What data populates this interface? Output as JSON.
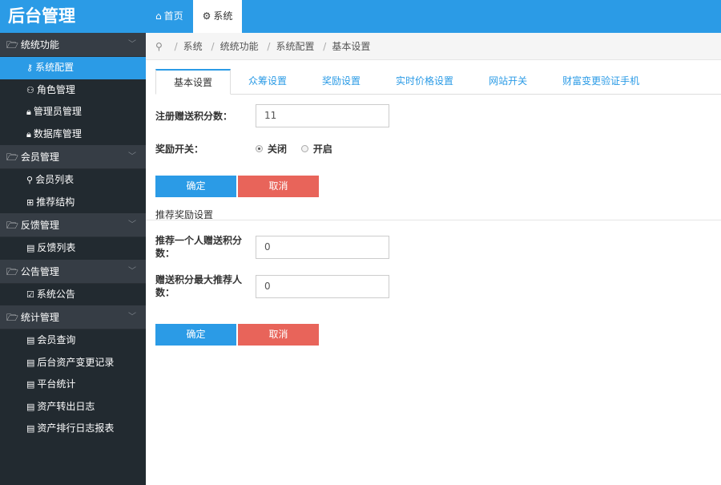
{
  "app": {
    "logo": "后台管理"
  },
  "topnav": {
    "items": [
      {
        "label": "首页",
        "icon": "home-icon"
      },
      {
        "label": "系统",
        "icon": "gear-icon"
      }
    ]
  },
  "sidebar": {
    "groups": [
      {
        "title": "统统功能",
        "items": [
          {
            "label": "系统配置",
            "icon": "wrench-icon"
          },
          {
            "label": "角色管理",
            "icon": "users-icon"
          },
          {
            "label": "管理员管理",
            "icon": "lock-icon"
          },
          {
            "label": "数据库管理",
            "icon": "lock-icon"
          }
        ]
      },
      {
        "title": "会员管理",
        "items": [
          {
            "label": "会员列表",
            "icon": "user-icon"
          },
          {
            "label": "推荐结构",
            "icon": "grid-icon"
          }
        ]
      },
      {
        "title": "反馈管理",
        "items": [
          {
            "label": "反馈列表",
            "icon": "document-icon"
          }
        ]
      },
      {
        "title": "公告管理",
        "items": [
          {
            "label": "系统公告",
            "icon": "checkbox-icon"
          }
        ]
      },
      {
        "title": "统计管理",
        "items": [
          {
            "label": "会员查询",
            "icon": "document-icon"
          },
          {
            "label": "后台资产变更记录",
            "icon": "document-icon"
          },
          {
            "label": "平台统计",
            "icon": "document-icon"
          },
          {
            "label": "资产转出日志",
            "icon": "document-icon"
          },
          {
            "label": "资产排行日志报表",
            "icon": "document-icon"
          }
        ]
      }
    ]
  },
  "breadcrumb": {
    "items": [
      "系统",
      "统统功能",
      "系统配置",
      "基本设置"
    ],
    "sep": "/"
  },
  "tabs": [
    "基本设置",
    "众筹设置",
    "奖励设置",
    "实时价格设置",
    "网站开关",
    "财富变更验证手机"
  ],
  "form": {
    "register_points_label": "注册赠送积分数：",
    "register_points_value": "11",
    "reward_switch_label": "奖励开关：",
    "radio_off": "关闭",
    "radio_on": "开启",
    "confirm": "确定",
    "cancel": "取消",
    "section_title": "推荐奖励设置",
    "refer_points_label": "推荐一个人赠送积分数：",
    "refer_points_value": "0",
    "max_refer_label": "赠送积分最大推荐人数：",
    "max_refer_value": "0"
  },
  "colors": {
    "accent": "#2b9be6",
    "danger": "#e8645a",
    "sidebar_bg": "#222a30",
    "sidebar_head": "#363d45"
  }
}
